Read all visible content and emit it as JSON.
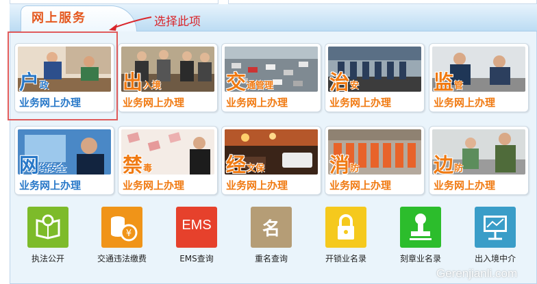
{
  "header": {
    "title": "网上服务"
  },
  "annotation": {
    "text": "选择此项"
  },
  "cards": [
    {
      "big": "户",
      "rest": "政",
      "sub": "业务网上办理",
      "theme": "blue"
    },
    {
      "big": "出",
      "rest": "入境",
      "sub": "业务网上办理",
      "theme": "orange"
    },
    {
      "big": "交",
      "rest": "通管理",
      "sub": "业务网上办理",
      "theme": "orange"
    },
    {
      "big": "治",
      "rest": "安",
      "sub": "业务网上办理",
      "theme": "orange"
    },
    {
      "big": "监",
      "rest": "管",
      "sub": "业务网上办理",
      "theme": "orange"
    },
    {
      "big": "网",
      "rest": "络安全",
      "sub": "业务网上办理",
      "theme": "blue"
    },
    {
      "big": "禁",
      "rest": "毒",
      "sub": "业务网上办理",
      "theme": "orange"
    },
    {
      "big": "经",
      "rest": "文保",
      "sub": "业务网上办理",
      "theme": "orange"
    },
    {
      "big": "消",
      "rest": "防",
      "sub": "业务网上办理",
      "theme": "orange"
    },
    {
      "big": "边",
      "rest": "防",
      "sub": "业务网上办理",
      "theme": "orange"
    }
  ],
  "services": [
    {
      "label": "执法公开",
      "icon": "book-search-icon",
      "color": "#7dbb2a"
    },
    {
      "label": "交通违法缴费",
      "icon": "coins-yen-icon",
      "color": "#f09418"
    },
    {
      "label": "EMS查询",
      "icon": "ems-icon",
      "icon_text": "EMS",
      "color": "#e6412c"
    },
    {
      "label": "重名查询",
      "icon": "name-icon",
      "icon_text": "名",
      "color": "#b59d76"
    },
    {
      "label": "开锁业名录",
      "icon": "lock-icon",
      "color": "#f5c91d"
    },
    {
      "label": "刻章业名录",
      "icon": "stamp-icon",
      "color": "#2cbd2c"
    },
    {
      "label": "出入境中介",
      "icon": "presentation-icon",
      "color": "#3a9dc8"
    }
  ],
  "watermark": {
    "text": "Gerenjianli.com"
  },
  "colors": {
    "blue_text": "#2878c8",
    "orange_text": "#f07a12",
    "title": "#e4571d",
    "annotation": "#d9262b"
  }
}
